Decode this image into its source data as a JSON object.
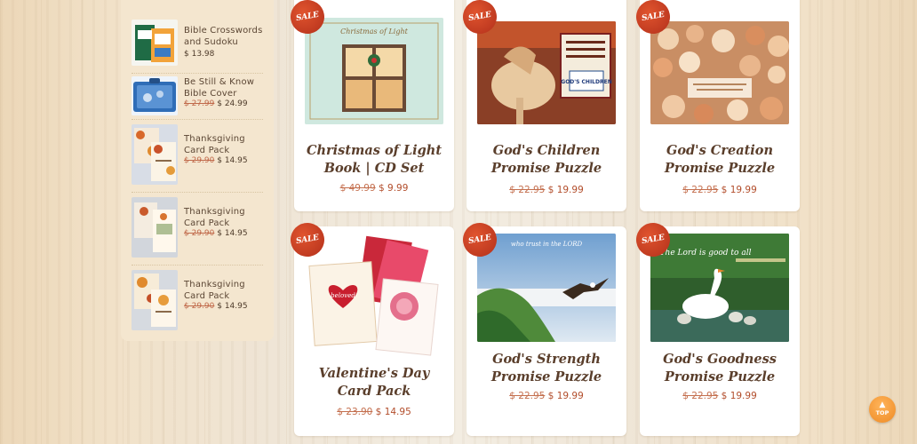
{
  "sidebar": {
    "items": [
      {
        "title": "Bible Crosswords and Sudoku",
        "old_price": "",
        "price": "$ 13.98"
      },
      {
        "title": "Be Still & Know Bible Cover",
        "old_price": "$ 27.99",
        "price": "$ 24.99"
      },
      {
        "title": "Thanksgiving Card Pack",
        "old_price": "$ 29.90",
        "price": "$ 14.95"
      },
      {
        "title": "Thanksgiving Card Pack",
        "old_price": "$ 29.90",
        "price": "$ 14.95"
      },
      {
        "title": "Thanksgiving Card Pack",
        "old_price": "$ 29.90",
        "price": "$ 14.95"
      }
    ]
  },
  "products": [
    {
      "badge": "SALE",
      "title": "Christmas of Light Book | CD Set",
      "old_price": "$ 49.99",
      "price": "$ 9.99",
      "image_text": "Christmas of Light"
    },
    {
      "badge": "SALE",
      "title": "God's Children Promise Puzzle",
      "old_price": "$ 22.95",
      "price": "$ 19.99",
      "image_text": "GOD'S CHILDREN"
    },
    {
      "badge": "SALE",
      "title": "God's Creation Promise Puzzle",
      "old_price": "$ 22.95",
      "price": "$ 19.99",
      "image_text": ""
    },
    {
      "badge": "SALE",
      "title": "Valentine's Day Card Pack",
      "old_price": "$ 23.90",
      "price": "$ 14.95",
      "image_text": "beloved"
    },
    {
      "badge": "SALE",
      "title": "God's Strength Promise Puzzle",
      "old_price": "$ 22.95",
      "price": "$ 19.99",
      "image_text": "who trust in the LORD"
    },
    {
      "badge": "SALE",
      "title": "God's Goodness Promise Puzzle",
      "old_price": "$ 22.95",
      "price": "$ 19.99",
      "image_text": "The Lord is good to all"
    }
  ],
  "back_to_top": {
    "label": "TOP",
    "icon": "chevron-up-icon"
  },
  "colors": {
    "sale_badge": "#c73a1f",
    "price_new": "#b24d2b",
    "title": "#5a3e2b",
    "sidebar_bg": "#f4e6cf"
  }
}
